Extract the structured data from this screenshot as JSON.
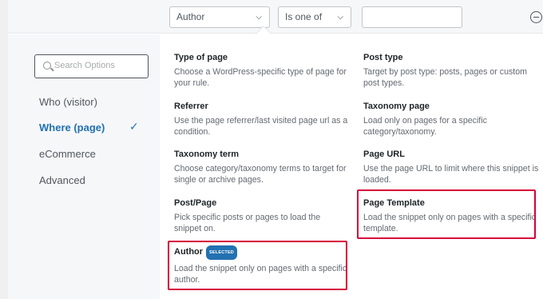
{
  "topbar": {
    "field_select": "Author",
    "operator_select": "Is one of",
    "value_input": ""
  },
  "sidebar": {
    "search_placeholder": "Search Options",
    "items": [
      {
        "label": "Who (visitor)",
        "active": false
      },
      {
        "label": "Where (page)",
        "active": true
      },
      {
        "label": "eCommerce",
        "active": false
      },
      {
        "label": "Advanced",
        "active": false
      }
    ]
  },
  "options": [
    {
      "title": "Type of page",
      "desc": "Choose a WordPress-specific type of page for your rule."
    },
    {
      "title": "Post type",
      "desc": "Target by post type: posts, pages or custom post types."
    },
    {
      "title": "Referrer",
      "desc": "Use the page referrer/last visited page url as a condition."
    },
    {
      "title": "Taxonomy page",
      "desc": "Load only on pages for a specific category/taxonomy."
    },
    {
      "title": "Taxonomy term",
      "desc": "Choose category/taxonomy terms to target for single or archive pages."
    },
    {
      "title": "Page URL",
      "desc": "Use the page URL to limit where this snippet is loaded."
    },
    {
      "title": "Post/Page",
      "desc": "Pick specific posts or pages to load the snippet on."
    },
    {
      "title": "Page Template",
      "desc": "Load the snippet only on pages with a specific template."
    },
    {
      "title": "Author",
      "badge": "SELECTED",
      "desc": "Load the snippet only on pages with a specific author."
    }
  ],
  "colors": {
    "accent": "#2271b1",
    "highlight": "#d6003c"
  }
}
